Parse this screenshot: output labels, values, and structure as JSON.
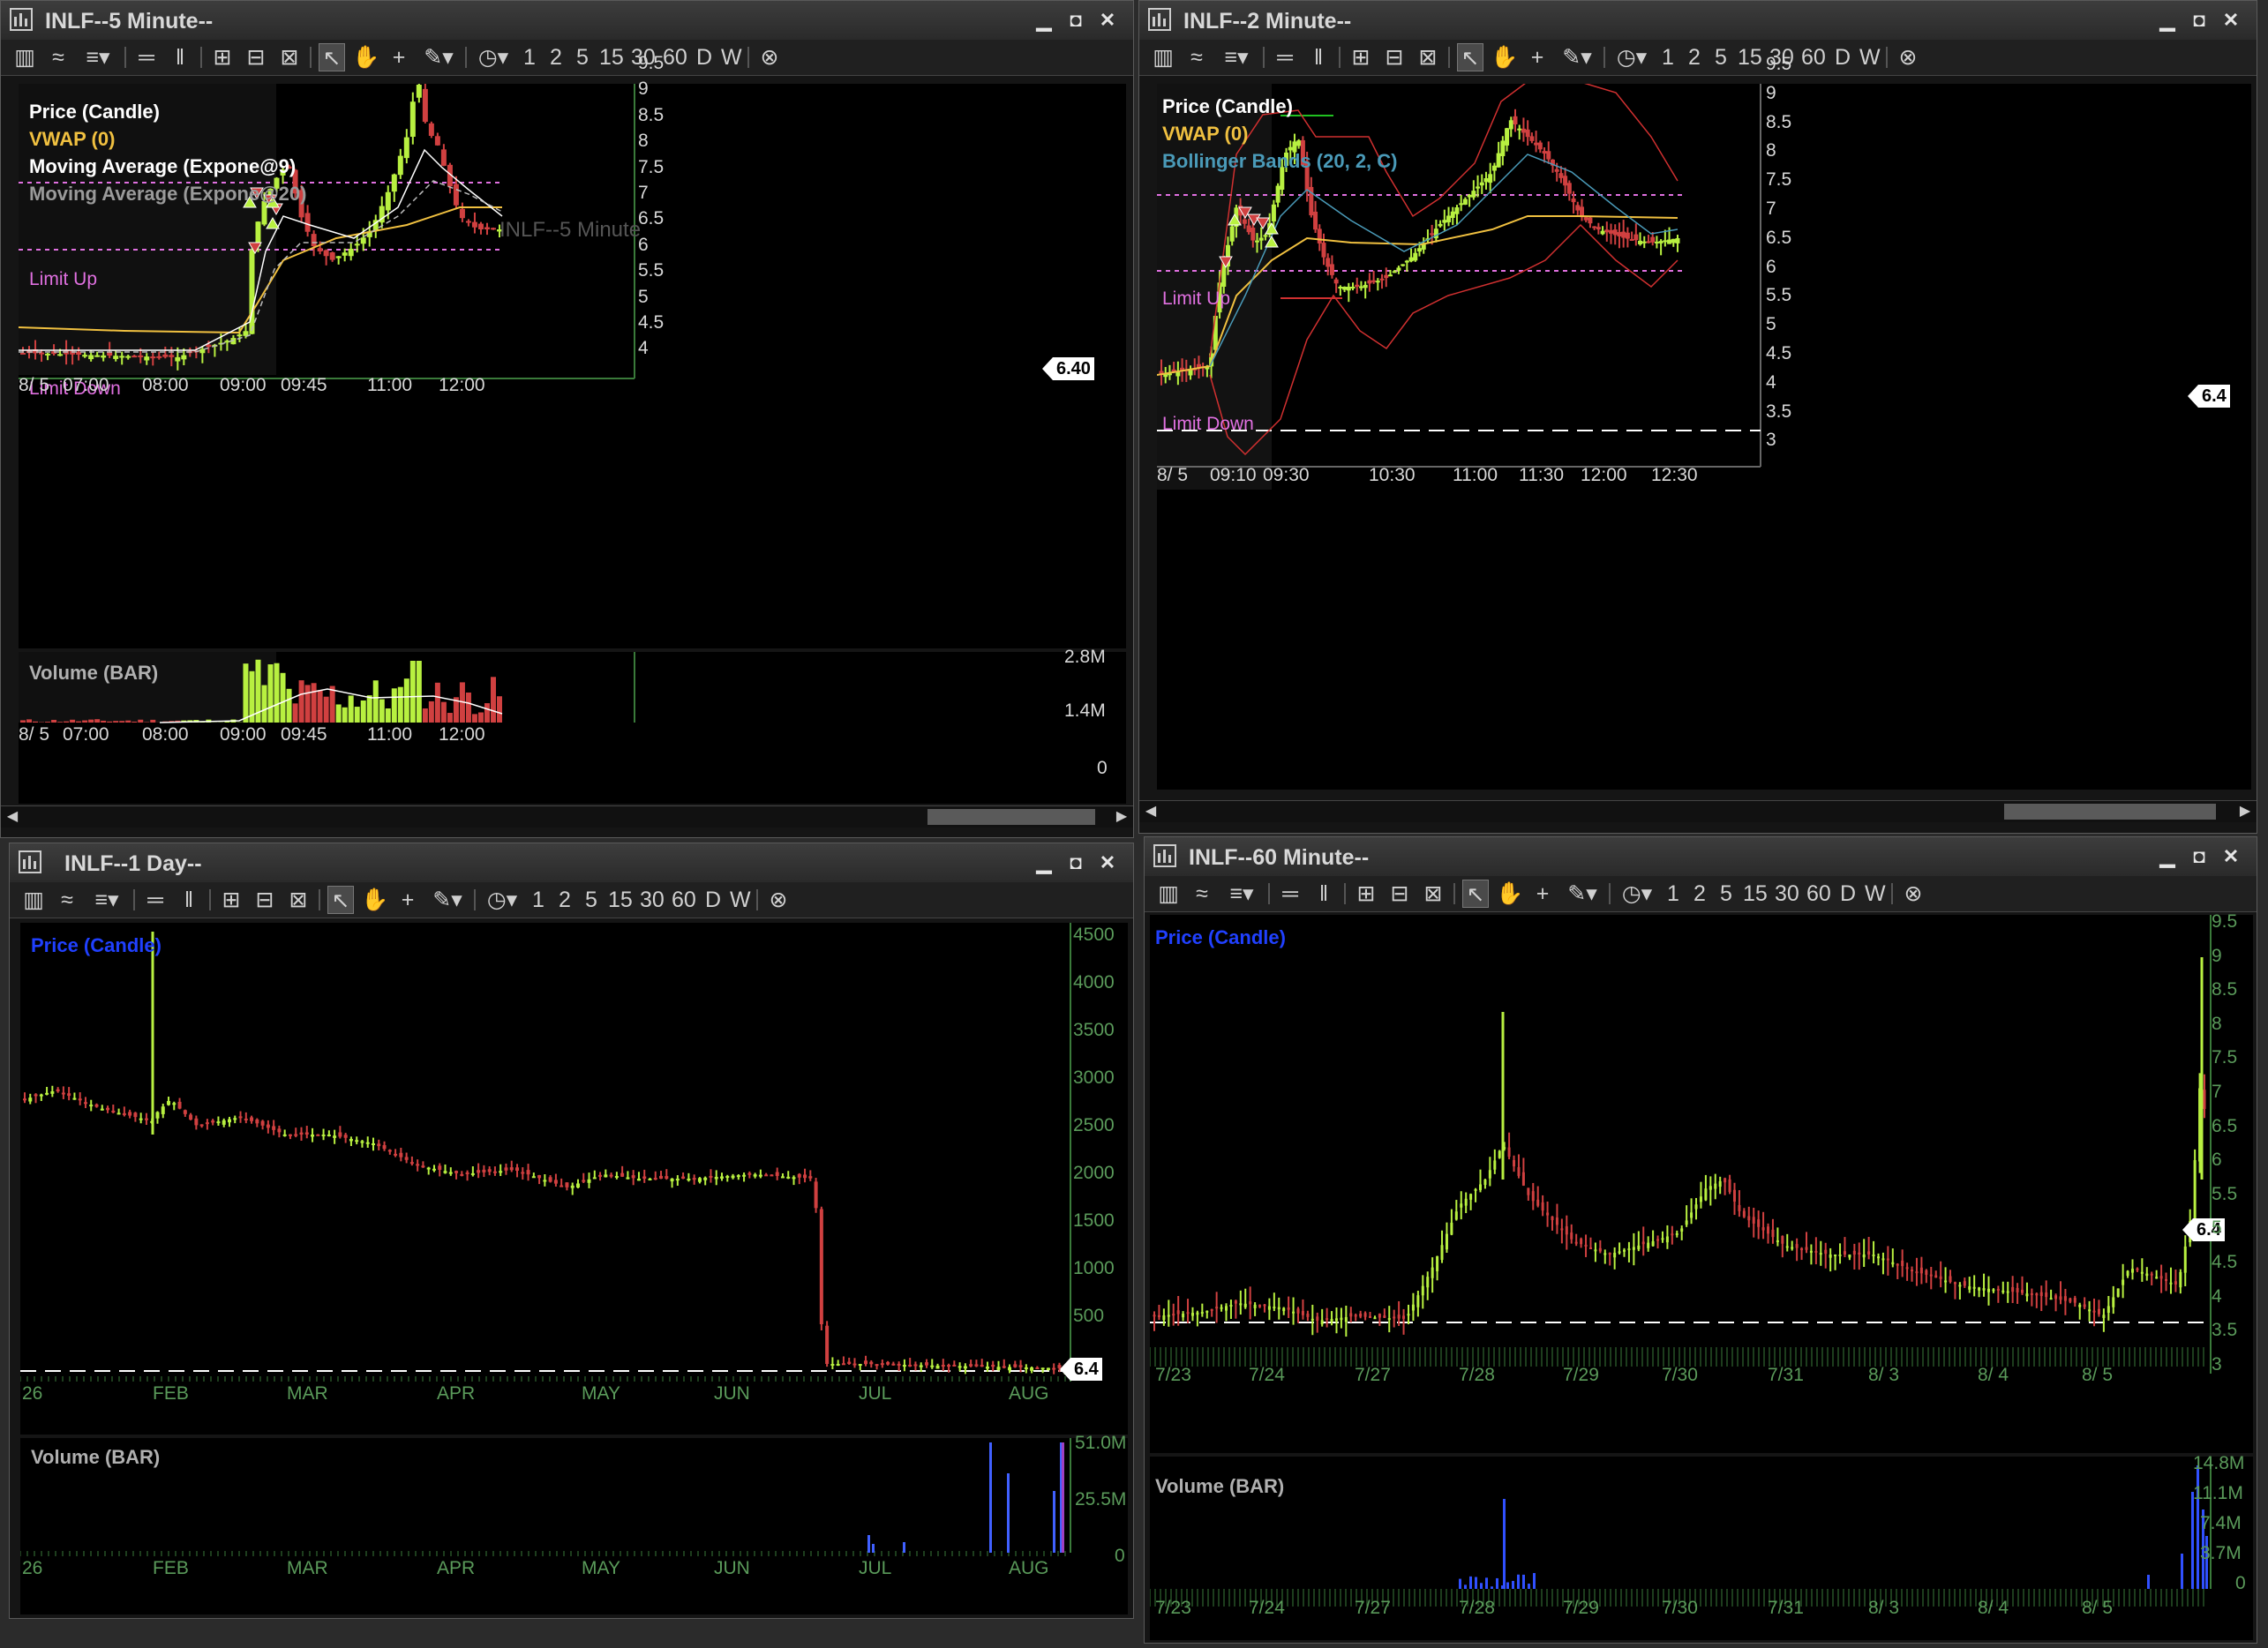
{
  "toolbar_items": [
    "chart-type-icon",
    "line-style-icon",
    "indicator-icon",
    "hline-icon",
    "vline-icon",
    "zoom-in-icon",
    "zoom-out-icon",
    "zoom-fit-icon",
    "cursor-icon",
    "hand-icon",
    "crosshair-icon",
    "pen-icon",
    "clock-icon"
  ],
  "periods": [
    "1",
    "2",
    "5",
    "15",
    "30",
    "60",
    "D",
    "W"
  ],
  "windows": {
    "w5": {
      "title": "INLF--5 Minute--",
      "watermark": "INLF--5 Minute",
      "legend": [
        {
          "text": "Price (Candle)",
          "color": "#ffffff"
        },
        {
          "text": "VWAP (0)",
          "color": "#f0c040"
        },
        {
          "text": "Moving Average (Expone@9)",
          "color": "#ffffff"
        },
        {
          "text": "Moving Average (Expone@20)",
          "color": "#9a9a9a"
        }
      ],
      "limit_up": "Limit Up",
      "limit_down": "Limit Down",
      "price_tag": "6.40",
      "y_ticks": [
        "9.5",
        "9",
        "8.5",
        "8",
        "7.5",
        "7",
        "6.5",
        "6",
        "5.5",
        "5",
        "4.5",
        "4"
      ],
      "x_ticks": [
        "8/ 5",
        "07:00",
        "08:00",
        "09:00",
        "09:45",
        "11:00",
        "12:00"
      ],
      "volume_label": "Volume (BAR)",
      "vol_ticks": [
        "2.8M",
        "1.4M",
        "0"
      ]
    },
    "w2": {
      "title": "INLF--2 Minute--",
      "legend": [
        {
          "text": "Price (Candle)",
          "color": "#ffffff"
        },
        {
          "text": "VWAP (0)",
          "color": "#f0c040"
        },
        {
          "text": "Bollinger Bands (20, 2, C)",
          "color": "#4a9ab8"
        }
      ],
      "limit_up": "Limit Up",
      "limit_down": "Limit Down",
      "price_tag": "6.4",
      "y_ticks": [
        "9.5",
        "9",
        "8.5",
        "8",
        "7.5",
        "7",
        "6.5",
        "6",
        "5.5",
        "5",
        "4.5",
        "4",
        "3.5",
        "3"
      ],
      "x_ticks": [
        "8/ 5",
        "09:10",
        "09:30",
        "10:30",
        "11:00",
        "11:30",
        "12:00",
        "12:30"
      ]
    },
    "wd": {
      "title": "INLF--1 Day--",
      "legend": [
        {
          "text": "Price (Candle)",
          "color": "#2040ff"
        }
      ],
      "price_tag": "6.4",
      "y_ticks": [
        "4500",
        "4000",
        "3500",
        "3000",
        "2500",
        "2000",
        "1500",
        "1000",
        "500"
      ],
      "x_ticks": [
        "26",
        "FEB",
        "MAR",
        "APR",
        "MAY",
        "JUN",
        "JUL",
        "AUG"
      ],
      "volume_label": "Volume (BAR)",
      "vol_ticks": [
        "51.0M",
        "25.5M",
        "0"
      ]
    },
    "w60": {
      "title": "INLF--60 Minute--",
      "legend": [
        {
          "text": "Price (Candle)",
          "color": "#2040ff"
        }
      ],
      "price_tag": "6.4",
      "y_ticks": [
        "9.5",
        "9",
        "8.5",
        "8",
        "7.5",
        "7",
        "6.5",
        "6",
        "5.5",
        "5",
        "4.5",
        "4",
        "3.5",
        "3"
      ],
      "x_ticks": [
        "7/23",
        "7/24",
        "7/27",
        "7/28",
        "7/29",
        "7/30",
        "7/31",
        "8/ 3",
        "8/ 4",
        "8/ 5"
      ],
      "volume_label": "Volume (BAR)",
      "vol_ticks": [
        "14.8M",
        "11.1M",
        "7.4M",
        "3.7M",
        "0"
      ]
    }
  },
  "colors": {
    "up": "#b8f040",
    "down": "#d04040",
    "vwap": "#f0c040",
    "limit": "#e070e0",
    "bb": "#d03030",
    "bbmid": "#4a9ab8"
  }
}
